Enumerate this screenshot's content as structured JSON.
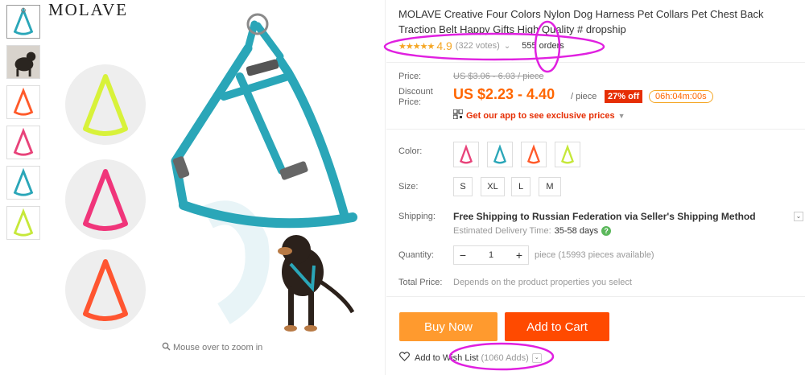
{
  "gallery": {
    "brand": "MOLAVE",
    "zoom_hint": "Mouse over to zoom in",
    "thumbnails": [
      "blue-harness",
      "dog-photo",
      "orange-harness",
      "pink-harness",
      "blue-harness",
      "yellow-harness"
    ]
  },
  "product": {
    "title": "MOLAVE Creative Four Colors Nylon Dog Harness Pet Collars Pet Chest Back Traction Belt Happy Gifts High Quality # dropship",
    "rating": "4.9",
    "stars": "★★★★★",
    "votes": "(322 votes)",
    "orders": "555 orders"
  },
  "price": {
    "label": "Price:",
    "original": "US $3.06 - 6.03 / piece",
    "discount_label": "Discount Price:",
    "discount": "US $2.23 - 4.40",
    "per_piece": "/ piece",
    "off_badge": "27% off",
    "timer": "06h:04m:00s",
    "app_promo": "Get our app to see exclusive prices"
  },
  "options": {
    "color_label": "Color:",
    "colors": [
      "#e8437a",
      "#2aa6b8",
      "#ff5a2a",
      "#c6e83a"
    ],
    "size_label": "Size:",
    "sizes": [
      "S",
      "XL",
      "L",
      "M"
    ]
  },
  "shipping": {
    "label": "Shipping:",
    "text": "Free Shipping to Russian Federation via Seller's Shipping Method",
    "delivery_label": "Estimated Delivery Time:",
    "delivery_days": "35-58 days"
  },
  "quantity": {
    "label": "Quantity:",
    "value": "1",
    "available": "piece (15993 pieces available)"
  },
  "total": {
    "label": "Total Price:",
    "text": "Depends on the product properties you select"
  },
  "actions": {
    "buy_now": "Buy Now",
    "add_to_cart": "Add to Cart",
    "wish_label": "Add to Wish List",
    "wish_adds": "(1060 Adds)"
  },
  "colors": {
    "annotation": "#e020e0",
    "harness_blue": "#2aa6b8",
    "accent_orange": "#ff6600",
    "cart_red": "#ff4a00"
  }
}
